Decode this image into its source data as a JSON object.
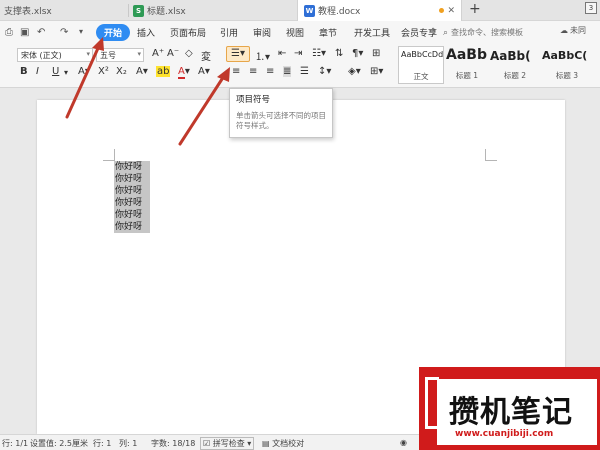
{
  "tabs": [
    {
      "label": "支撑表.xlsx",
      "type_letter": "",
      "color": "#2e9a55"
    },
    {
      "label": "标题.xlsx",
      "type_letter": "S",
      "color": "#2e9a55"
    },
    {
      "label": "教程.docx",
      "type_letter": "W",
      "color": "#2f6fd6",
      "active": true
    }
  ],
  "tab_badge": "3",
  "menu": {
    "items": [
      "开始",
      "插入",
      "页面布局",
      "引用",
      "审阅",
      "视图",
      "章节",
      "开发工具",
      "会员专享"
    ],
    "search_placeholder": "查找命令、搜索模板",
    "unsync_label": "未同"
  },
  "ribbon": {
    "font_name": "宋体 (正文)",
    "font_size": "五号",
    "styles": [
      {
        "sample": "AaBbCcDd",
        "label": "正文"
      },
      {
        "sample": "AaBb",
        "label": "标题 1"
      },
      {
        "sample": "AaBb(",
        "label": "标题 2"
      },
      {
        "sample": "AaBbC(",
        "label": "标题 3"
      }
    ]
  },
  "tooltip": {
    "title": "项目符号",
    "description": "单击箭头可选择不同的项目符号样式。"
  },
  "document": {
    "lines": [
      "你好呀",
      "你好呀",
      "你好呀",
      "你好呀",
      "你好呀",
      "你好呀"
    ]
  },
  "status": {
    "row": "行: 1/1",
    "setting": "设置值: 2.5厘米",
    "line": "行: 1",
    "col": "列: 1",
    "words": "字数: 18/18",
    "spell": "拼写检查",
    "proof": "文档校对"
  },
  "watermark": {
    "brand": "攒机笔记",
    "url": "www.cuanjibiji.com"
  },
  "colors": {
    "accent": "#2f8cf2",
    "arrow": "#c0392b",
    "watermark_red": "#d01b1b"
  }
}
